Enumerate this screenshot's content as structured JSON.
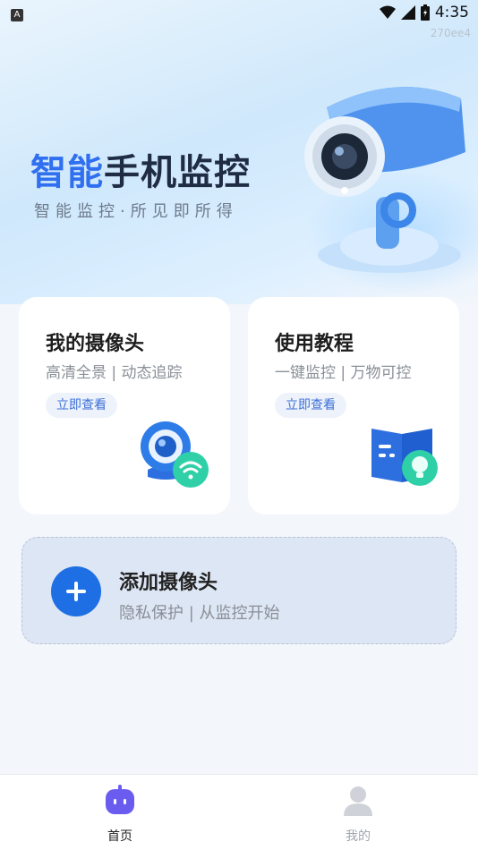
{
  "status_bar": {
    "left_badge": "A",
    "time": "4:35",
    "icons": [
      "wifi-icon",
      "signal-icon",
      "battery-icon"
    ]
  },
  "build_id": "270ee4",
  "hero": {
    "title_accent": "智能",
    "title_rest": "手机监控",
    "subtitle": "智能监控·所见即所得",
    "illustration": "security-camera-icon"
  },
  "cards": [
    {
      "title": "我的摄像头",
      "subtitle": "高清全景 | 动态追踪",
      "action": "立即查看",
      "icon": "camera-wifi-icon"
    },
    {
      "title": "使用教程",
      "subtitle": "一键监控 | 万物可控",
      "action": "立即查看",
      "icon": "book-bulb-icon"
    }
  ],
  "add_camera": {
    "title": "添加摄像头",
    "subtitle": "隐私保护 | 从监控开始",
    "icon": "plus-icon"
  },
  "tabs": [
    {
      "label": "首页",
      "icon": "home-robot-icon",
      "active": true
    },
    {
      "label": "我的",
      "icon": "user-icon",
      "active": false
    }
  ],
  "colors": {
    "accent": "#2f6ff0",
    "primary_button": "#1e6fe3",
    "tab_active_icon": "#6b5cf0"
  }
}
